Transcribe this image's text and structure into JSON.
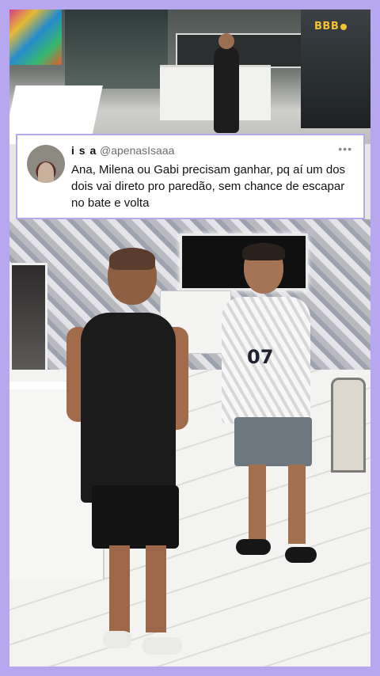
{
  "tweet": {
    "display_name": "i s a",
    "handle": "@apenasIsaaa",
    "more_label": "•••",
    "text": "Ana, Milena ou Gabi precisam ganhar, pq aí um dos dois vai direto pro paredão, sem chance de escapar no bate e volta"
  },
  "video_top": {
    "logo_text": "BBB"
  },
  "jersey": {
    "number": "07"
  },
  "colors": {
    "background_frame": "#b7a7ef",
    "card_bg": "#ffffff",
    "handle": "#6d6d6d",
    "logo": "#f2c230"
  }
}
